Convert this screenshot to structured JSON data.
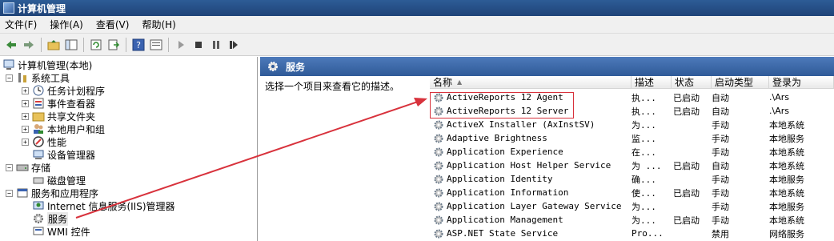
{
  "window": {
    "title": "计算机管理"
  },
  "menu": [
    "文件(F)",
    "操作(A)",
    "查看(V)",
    "帮助(H)"
  ],
  "toolbar": {
    "buttons": [
      "back-icon",
      "forward-icon",
      "up-folder-icon",
      "show-hide-tree-icon",
      "refresh-icon",
      "export-icon",
      "help-icon",
      "properties-icon",
      "play-icon",
      "stop-icon",
      "pause-icon",
      "restart-icon"
    ]
  },
  "tree": {
    "root": "计算机管理(本地)",
    "system_tools": "系统工具",
    "task_scheduler": "任务计划程序",
    "event_viewer": "事件查看器",
    "shared_folders": "共享文件夹",
    "local_users": "本地用户和组",
    "performance": "性能",
    "device_manager": "设备管理器",
    "storage": "存储",
    "disk_mgmt": "磁盘管理",
    "services_apps": "服务和应用程序",
    "iis": "Internet 信息服务(IIS)管理器",
    "services": "服务",
    "wmi": "WMI 控件"
  },
  "panel": {
    "title": "服务",
    "description": "选择一个项目来查看它的描述。"
  },
  "list": {
    "columns": {
      "name": "名称",
      "description": "描述",
      "status": "状态",
      "startup": "启动类型",
      "logon": "登录为"
    },
    "rows": [
      {
        "name": "ActiveReports 12 Agent",
        "description": "执...",
        "status": "已启动",
        "startup": "自动",
        "logon": ".\\Ars"
      },
      {
        "name": "ActiveReports 12 Server",
        "description": "执...",
        "status": "已启动",
        "startup": "自动",
        "logon": ".\\Ars"
      },
      {
        "name": "ActiveX Installer (AxInstSV)",
        "description": "为...",
        "status": "",
        "startup": "手动",
        "logon": "本地系统"
      },
      {
        "name": "Adaptive Brightness",
        "description": "监...",
        "status": "",
        "startup": "手动",
        "logon": "本地服务"
      },
      {
        "name": "Application Experience",
        "description": "在...",
        "status": "",
        "startup": "手动",
        "logon": "本地系统"
      },
      {
        "name": "Application Host Helper Service",
        "description": "为 ...",
        "status": "已启动",
        "startup": "自动",
        "logon": "本地系统"
      },
      {
        "name": "Application Identity",
        "description": "确...",
        "status": "",
        "startup": "手动",
        "logon": "本地服务"
      },
      {
        "name": "Application Information",
        "description": "使...",
        "status": "已启动",
        "startup": "手动",
        "logon": "本地系统"
      },
      {
        "name": "Application Layer Gateway Service",
        "description": "为...",
        "status": "",
        "startup": "手动",
        "logon": "本地服务"
      },
      {
        "name": "Application Management",
        "description": "为...",
        "status": "已启动",
        "startup": "手动",
        "logon": "本地系统"
      },
      {
        "name": "ASP.NET State Service",
        "description": "Pro...",
        "status": "",
        "startup": "禁用",
        "logon": "网络服务"
      }
    ]
  },
  "colors": {
    "annotation": "#d8323c",
    "header_blue": "#2f5a98"
  }
}
